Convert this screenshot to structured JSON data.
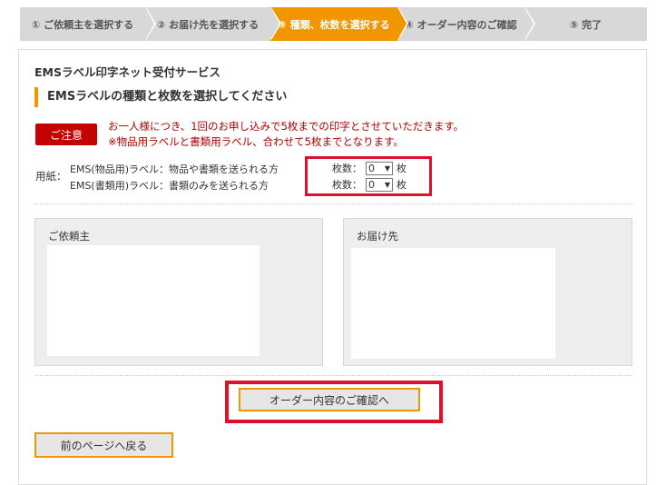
{
  "steps": [
    {
      "label": "① ご依頼主を選択する",
      "active": false
    },
    {
      "label": "② お届け先を選択する",
      "active": false
    },
    {
      "label": "③ 種類、枚数を選択する",
      "active": true
    },
    {
      "label": "④ オーダー内容のご確認",
      "active": false
    },
    {
      "label": "⑤ 完了",
      "active": false
    }
  ],
  "service_title": "EMSラベル印字ネット受付サービス",
  "section_heading": "EMSラベルの種類と枚数を選択してください",
  "notice": {
    "badge": "ご注意",
    "line1": "お一人様につき、1回のお申し込みで5枚までの印字とさせていただきます。",
    "line2": "※物品用ラベルと書類用ラベル、合わせて5枚までとなります。"
  },
  "paper": {
    "label": "用紙：",
    "rows": [
      {
        "description": "EMS(物品用)ラベル：物品や書類を送られる方",
        "qty_label": "枚数：",
        "qty_value": "0",
        "unit": "枚"
      },
      {
        "description": "EMS(書類用)ラベル：書類のみを送られる方",
        "qty_label": "枚数：",
        "qty_value": "0",
        "unit": "枚"
      }
    ]
  },
  "sender": {
    "title": "ご依頼主"
  },
  "recipient": {
    "title": "お届け先"
  },
  "buttons": {
    "confirm": "オーダー内容のご確認へ",
    "back": "前のページへ戻る"
  },
  "colors": {
    "accent": "#f29600",
    "highlight_red": "#e0102a",
    "notice_red": "#c40000"
  }
}
